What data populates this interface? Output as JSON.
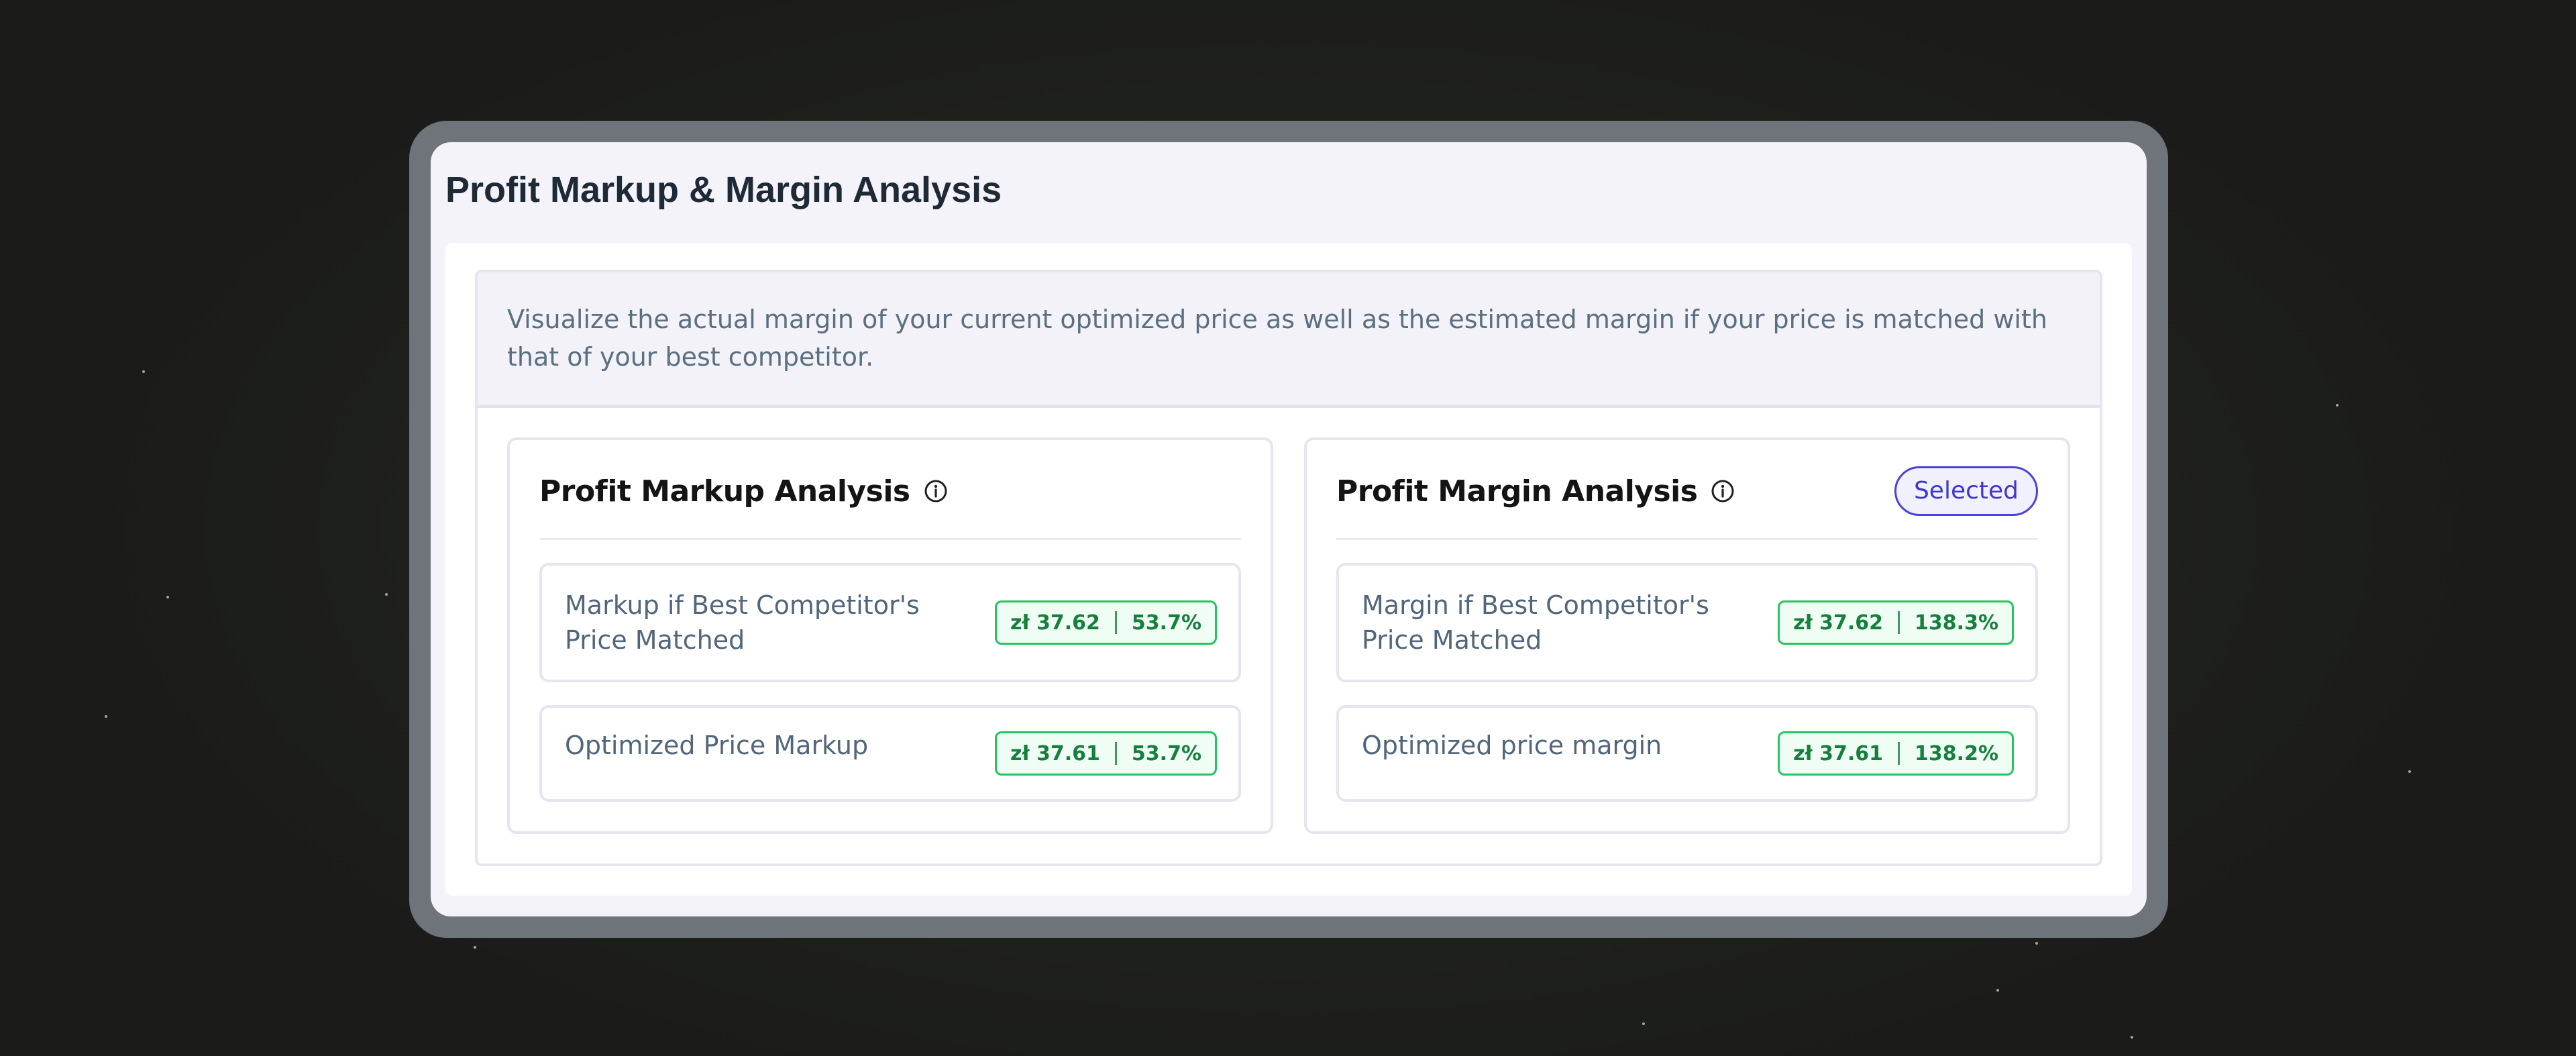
{
  "window": {
    "title": "Profit Markup & Margin Analysis"
  },
  "description": "Visualize the actual margin of your current optimized price as well as the estimated margin if your price is matched with that of your best competitor.",
  "cards": [
    {
      "title": "Profit Markup Analysis",
      "info_icon": "info-circle-icon",
      "badge": "",
      "rows": [
        {
          "label": "Markup if Best Competitor's Price Matched",
          "price": "zł 37.62",
          "percent": "53.7%"
        },
        {
          "label": "Optimized Price Markup",
          "price": "zł 37.61",
          "percent": "53.7%"
        }
      ]
    },
    {
      "title": "Profit Margin Analysis",
      "info_icon": "info-circle-icon",
      "badge": "Selected",
      "rows": [
        {
          "label": "Margin if Best Competitor's Price Matched",
          "price": "zł 37.62",
          "percent": "138.3%"
        },
        {
          "label": "Optimized price margin",
          "price": "zł 37.61",
          "percent": "138.2%"
        }
      ]
    }
  ],
  "colors": {
    "accent": "#4a43d8",
    "success": "#22c55e",
    "success_text": "#15803d"
  }
}
